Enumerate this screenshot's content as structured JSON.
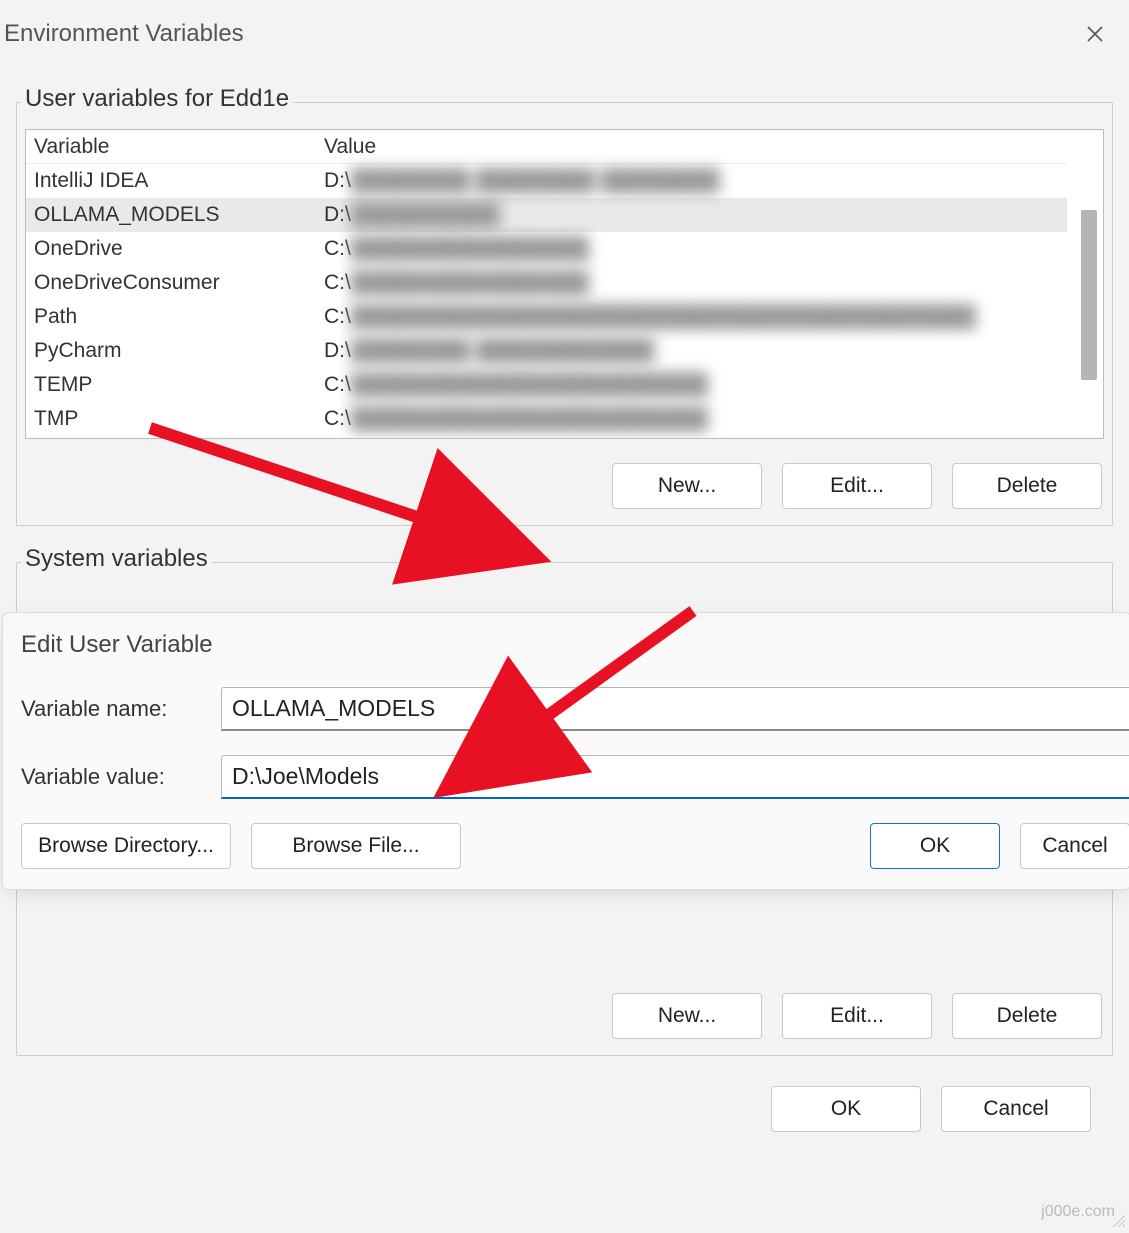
{
  "window": {
    "title": "Environment Variables"
  },
  "user_section": {
    "label": "User variables for Edd1e",
    "headers": {
      "variable": "Variable",
      "value": "Value"
    },
    "rows": [
      {
        "name": "IntelliJ IDEA",
        "value_prefix": "D:\\",
        "blurred_tail": "████████ ████████ ████████"
      },
      {
        "name": "OLLAMA_MODELS",
        "value_prefix": "D:\\",
        "blurred_tail": "██████████",
        "selected": true
      },
      {
        "name": "OneDrive",
        "value_prefix": "C:\\",
        "blurred_tail": "████████████████"
      },
      {
        "name": "OneDriveConsumer",
        "value_prefix": "C:\\",
        "blurred_tail": "████████████████"
      },
      {
        "name": "Path",
        "value_prefix": "C:\\",
        "blurred_tail": "██████████████████████████████████████████"
      },
      {
        "name": "PyCharm",
        "value_prefix": "D:\\",
        "blurred_tail": "████████ ████████████"
      },
      {
        "name": "TEMP",
        "value_prefix": "C:\\",
        "blurred_tail": "████████████████████████"
      },
      {
        "name": "TMP",
        "value_prefix": "C:\\",
        "blurred_tail": "████████████████████████"
      }
    ],
    "buttons": {
      "new": "New...",
      "edit": "Edit...",
      "delete": "Delete"
    }
  },
  "system_section": {
    "label": "System variables",
    "buttons": {
      "new": "New...",
      "edit": "Edit...",
      "delete": "Delete"
    }
  },
  "edit_dialog": {
    "title": "Edit User Variable",
    "name_label": "Variable name:",
    "value_label": "Variable value:",
    "name_value": "OLLAMA_MODELS",
    "value_value": "D:\\Joe\\Models",
    "buttons": {
      "browse_dir": "Browse Directory...",
      "browse_file": "Browse File...",
      "ok": "OK",
      "cancel": "Cancel"
    }
  },
  "outer_buttons": {
    "ok": "OK",
    "cancel": "Cancel"
  },
  "watermark": "j000e.com"
}
